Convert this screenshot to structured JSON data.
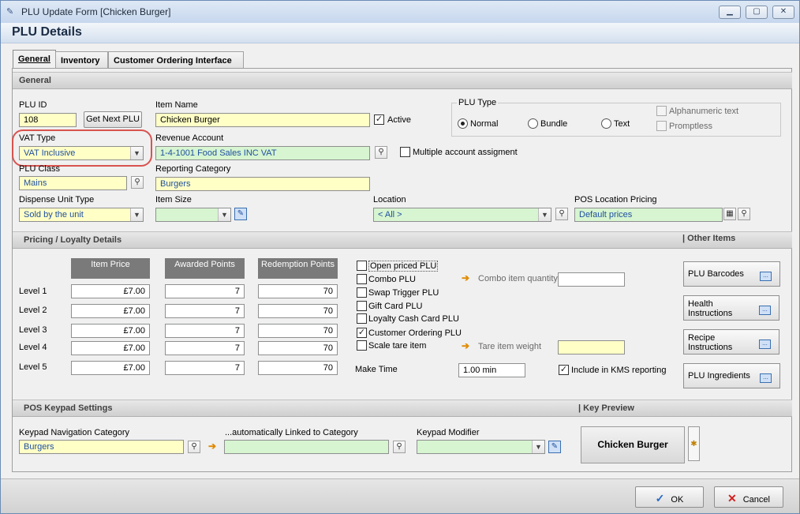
{
  "window": {
    "title": "PLU Update Form [Chicken Burger]"
  },
  "header": {
    "title": "PLU Details"
  },
  "tabs": [
    {
      "label": "General",
      "active": true
    },
    {
      "label": "Inventory",
      "active": false
    },
    {
      "label": "Customer Ordering Interface",
      "active": false
    }
  ],
  "general": {
    "section_title": "General",
    "plu_id_label": "PLU ID",
    "plu_id_value": "108",
    "get_next_plu": "Get Next PLU",
    "item_name_label": "Item Name",
    "item_name_value": "Chicken Burger",
    "active_label": "Active",
    "active_checked": true,
    "plu_type_label": "PLU Type",
    "plu_type_options": [
      "Normal",
      "Bundle",
      "Text"
    ],
    "plu_type_selected": "Normal",
    "alphanumeric_label": "Alphanumeric text",
    "promptless_label": "Promptless",
    "vat_type_label": "VAT Type",
    "vat_type_value": "VAT Inclusive",
    "revenue_account_label": "Revenue Account",
    "revenue_account_value": "1-4-1001  Food Sales INC VAT",
    "multiple_account_label": "Multiple account assigment",
    "plu_class_label": "PLU Class",
    "plu_class_value": "Mains",
    "reporting_category_label": "Reporting Category",
    "reporting_category_value": "Burgers",
    "dispense_unit_label": "Dispense Unit Type",
    "dispense_unit_value": "Sold by the unit",
    "item_size_label": "Item Size",
    "item_size_value": "",
    "location_label": "Location",
    "location_value": "< All >",
    "pos_location_pricing_label": "POS Location Pricing",
    "pos_location_pricing_value": "Default prices"
  },
  "pricing": {
    "section_title": "Pricing / Loyalty Details",
    "columns": [
      "Item Price",
      "Awarded Points",
      "Redemption Points"
    ],
    "levels": [
      {
        "label": "Level 1",
        "price": "£7.00",
        "awarded": "7",
        "redemption": "70"
      },
      {
        "label": "Level 2",
        "price": "£7.00",
        "awarded": "7",
        "redemption": "70"
      },
      {
        "label": "Level 3",
        "price": "£7.00",
        "awarded": "7",
        "redemption": "70"
      },
      {
        "label": "Level 4",
        "price": "£7.00",
        "awarded": "7",
        "redemption": "70"
      },
      {
        "label": "Level 5",
        "price": "£7.00",
        "awarded": "7",
        "redemption": "70"
      }
    ],
    "checks": [
      {
        "label": "Open priced PLU",
        "checked": false
      },
      {
        "label": "Combo PLU",
        "checked": false
      },
      {
        "label": "Swap Trigger PLU",
        "checked": false
      },
      {
        "label": "Gift Card PLU",
        "checked": false
      },
      {
        "label": "Loyalty Cash Card PLU",
        "checked": false
      },
      {
        "label": "Customer Ordering PLU",
        "checked": true
      },
      {
        "label": "Scale tare item",
        "checked": false
      }
    ],
    "combo_qty_label": "Combo item quantity",
    "tare_weight_label": "Tare item weight",
    "make_time_label": "Make Time",
    "make_time_value": "1.00 min",
    "kms_label": "Include in KMS reporting",
    "kms_checked": true
  },
  "other_items": {
    "title": "| Other Items",
    "buttons": [
      "PLU Barcodes",
      "Health Instructions",
      "Recipe Instructions",
      "PLU Ingredients"
    ]
  },
  "keypad": {
    "section_title": "POS Keypad Settings",
    "nav_category_label": "Keypad Navigation Category",
    "nav_category_value": "Burgers",
    "linked_label": "...automatically Linked to Category",
    "linked_value": "",
    "modifier_label": "Keypad Modifier",
    "modifier_value": "",
    "key_preview_label": "| Key Preview",
    "key_preview_text": "Chicken Burger"
  },
  "footer": {
    "ok": "OK",
    "cancel": "Cancel"
  },
  "icons": {
    "search": "search-icon",
    "dropdown": "chevron-down-icon",
    "arrow": "arrow-right-icon"
  }
}
